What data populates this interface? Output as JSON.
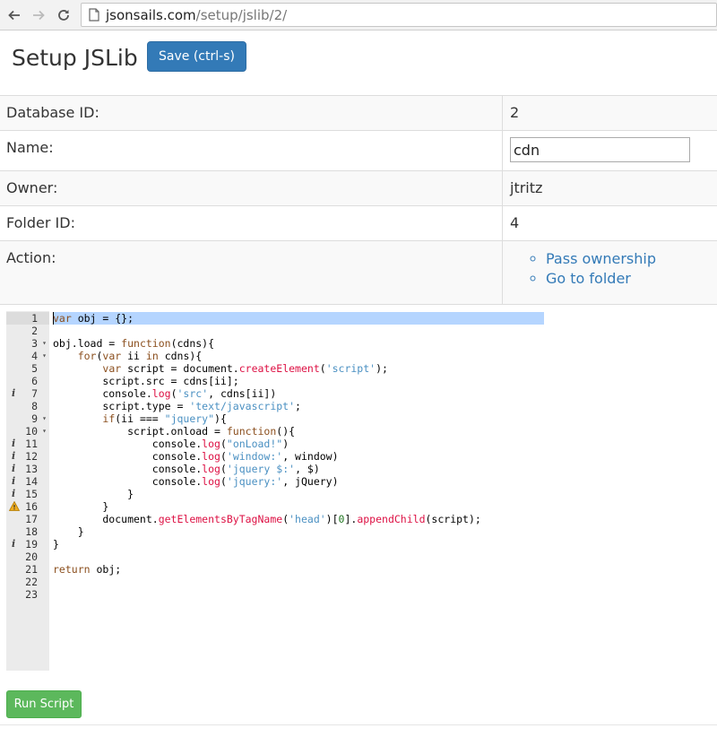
{
  "browser": {
    "url_host": "jsonsails.com",
    "url_path": "/setup/jslib/2/",
    "icons": [
      "back-arrow-icon",
      "forward-arrow-icon",
      "reload-icon",
      "page-icon"
    ]
  },
  "header": {
    "title": "Setup JSLib",
    "save_label": "Save (ctrl-s)"
  },
  "info": {
    "db_label": "Database ID:",
    "db_value": "2",
    "name_label": "Name:",
    "name_value": "cdn",
    "owner_label": "Owner:",
    "owner_value": "jtritz",
    "folder_label": "Folder ID:",
    "folder_value": "4",
    "action_label": "Action:",
    "actions": [
      "Pass ownership",
      "Go to folder"
    ]
  },
  "editor": {
    "line_numbers": [
      "1",
      "2",
      "3",
      "4",
      "5",
      "6",
      "7",
      "8",
      "9",
      "10",
      "11",
      "12",
      "13",
      "14",
      "15",
      "16",
      "17",
      "18",
      "19",
      "20",
      "21",
      "22",
      "23"
    ],
    "info_marker": "i",
    "lines": [
      "var obj = {};",
      "",
      "obj.load = function(cdns){",
      "    for(var ii in cdns){",
      "        var script = document.createElement('script');",
      "        script.src = cdns[ii];",
      "        console.log('src', cdns[ii])",
      "        script.type = 'text/javascript';",
      "        if(ii === \"jquery\"){",
      "            script.onload = function(){",
      "                console.log(\"onLoad!\")",
      "                console.log('window:', window)",
      "                console.log('jquery $:', $)",
      "                console.log('jquery:', jQuery)",
      "            }",
      "        }",
      "        document.getElementsByTagName('head')[0].appendChild(script);",
      "    }",
      "}",
      "",
      "return obj;",
      "",
      ""
    ]
  },
  "footer": {
    "run_label": "Run Script"
  },
  "colors": {
    "primary": "#337ab7",
    "success": "#5cb85c",
    "selection": "#b5d5ff",
    "gutter": "#ebebeb"
  }
}
